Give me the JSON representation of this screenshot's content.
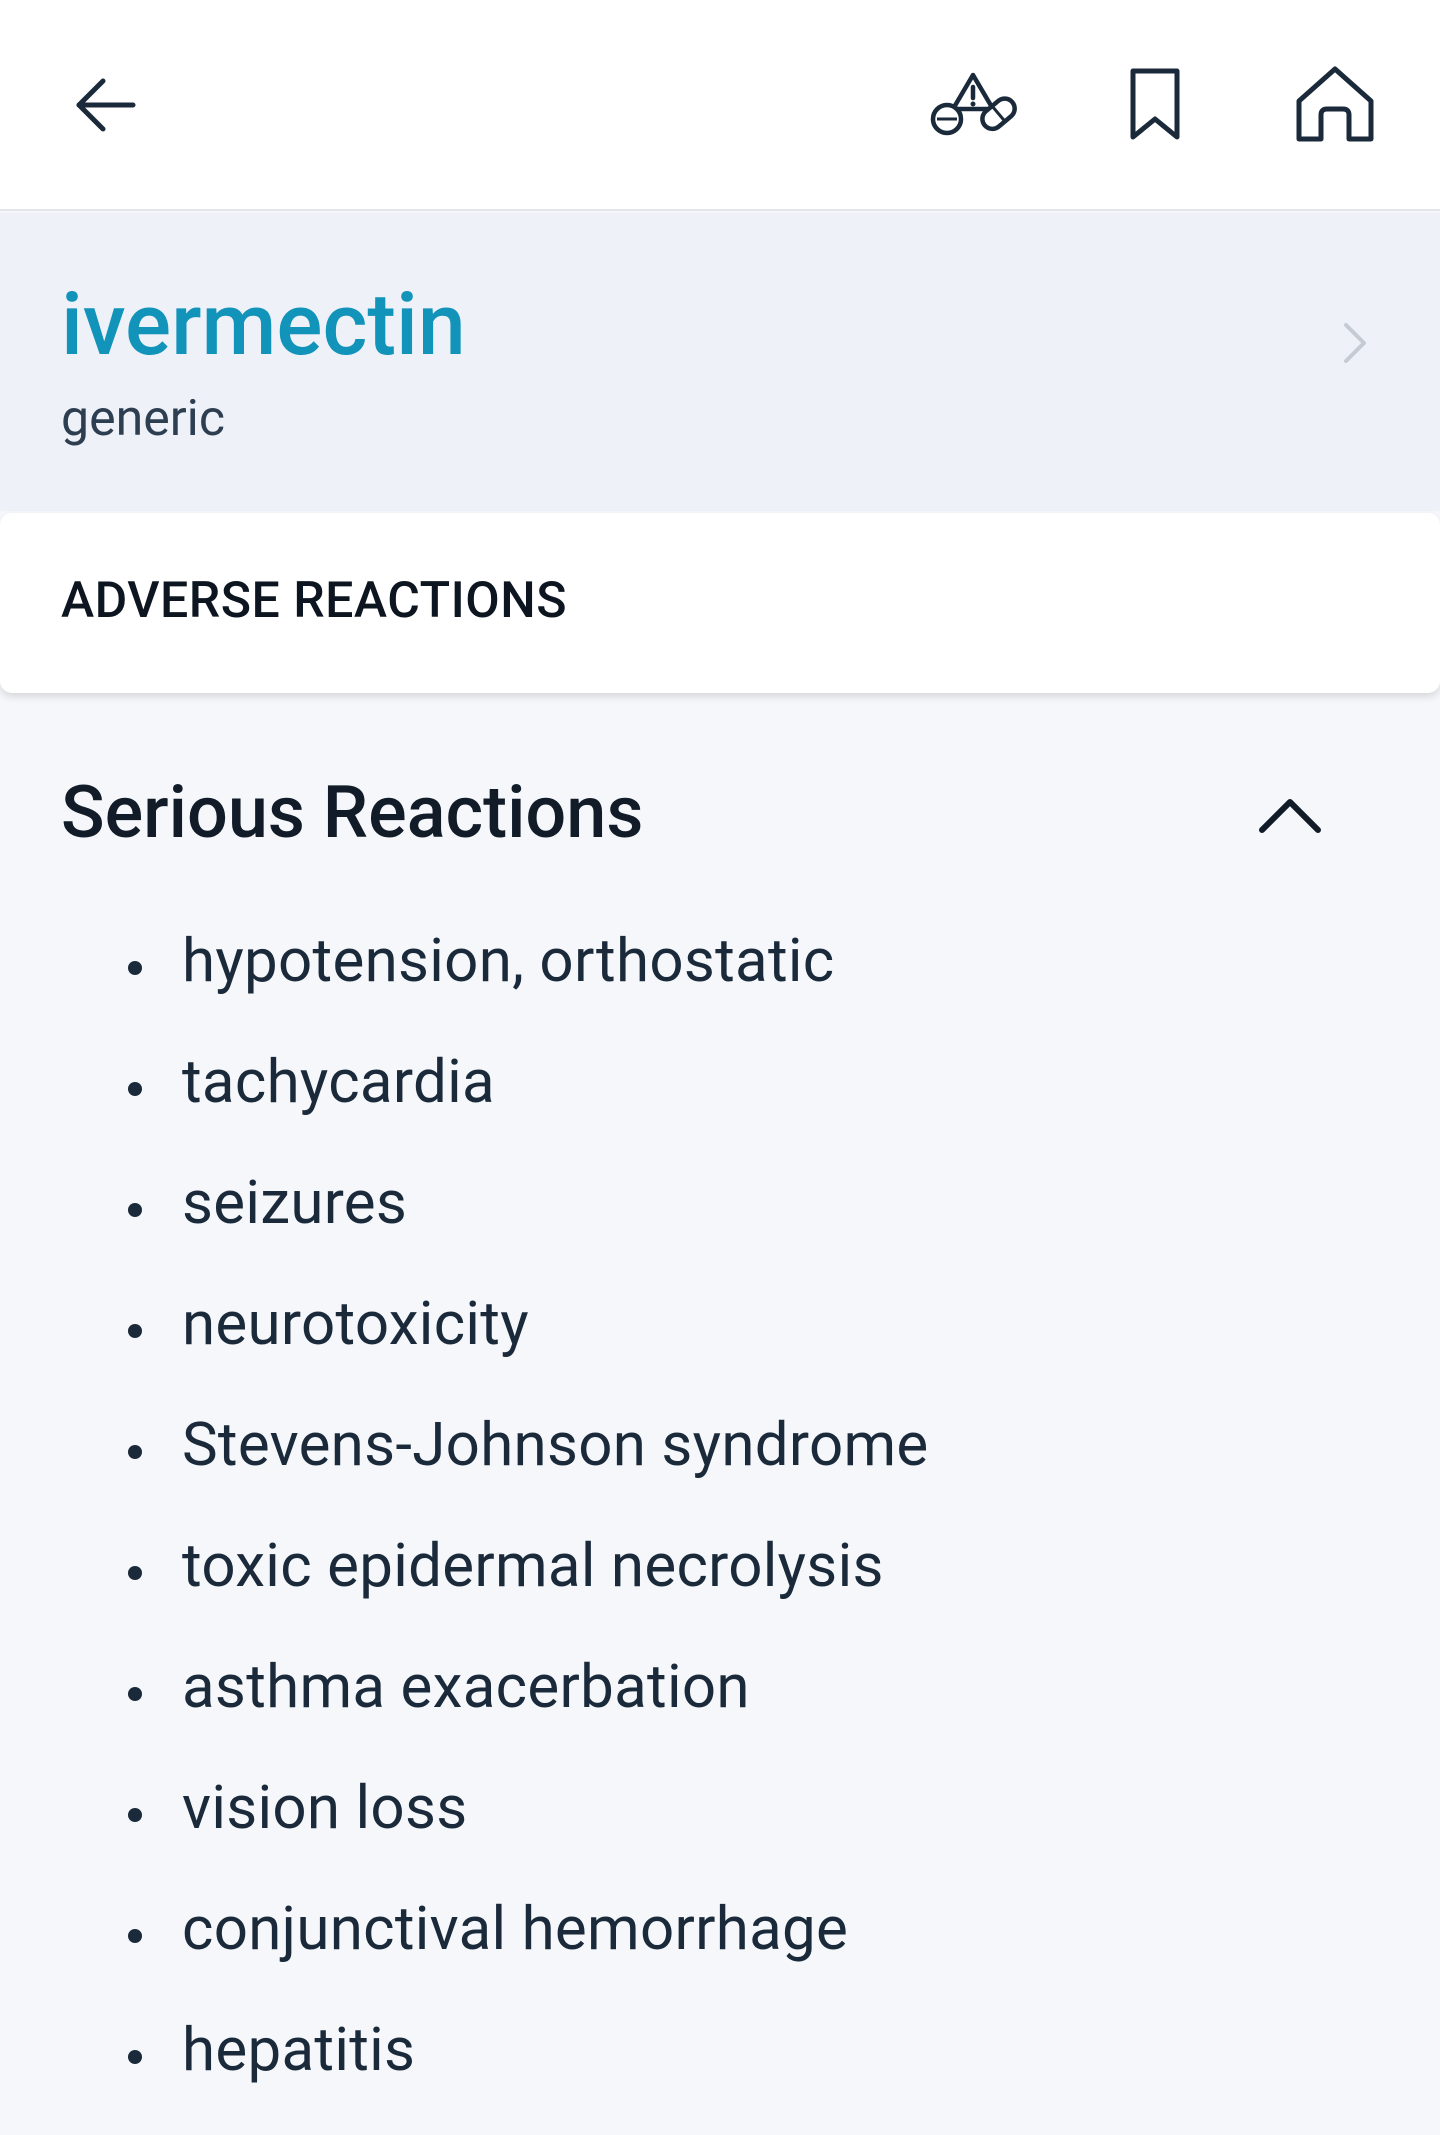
{
  "drug": {
    "name": "ivermectin",
    "type": "generic"
  },
  "section": {
    "title": "ADVERSE REACTIONS"
  },
  "serious_reactions": {
    "title": "Serious Reactions",
    "items": [
      "hypotension, orthostatic",
      "tachycardia",
      "seizures",
      "neurotoxicity",
      "Stevens-Johnson syndrome",
      "toxic epidermal necrolysis",
      "asthma exacerbation",
      "vision loss",
      "conjunctival hemorrhage",
      "hepatitis"
    ]
  },
  "icons": {
    "back": "arrow-left-icon",
    "interaction": "drug-interaction-icon",
    "bookmark": "bookmark-icon",
    "home": "home-icon",
    "drug_chevron": "chevron-right-icon",
    "collapse": "chevron-up-icon"
  },
  "colors": {
    "accent": "#1293b9",
    "header_bg": "#eef1f8",
    "page_bg": "#f5f7fa",
    "text": "#1b2a3a"
  }
}
